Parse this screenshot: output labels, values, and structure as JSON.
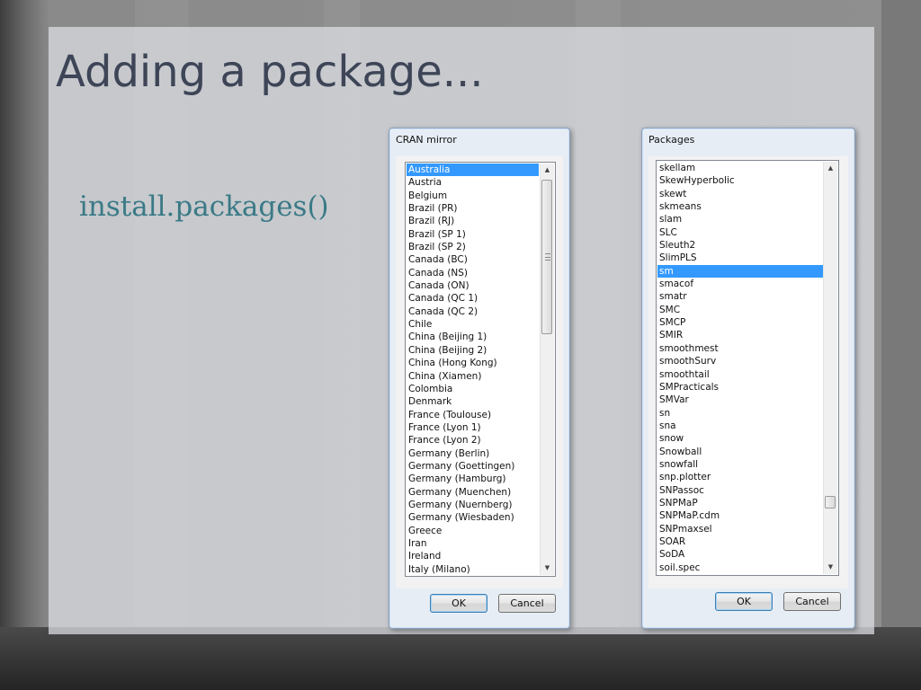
{
  "slide": {
    "title": "Adding a package...",
    "bullet": "install.packages()"
  },
  "cran_dialog": {
    "title": "CRAN mirror",
    "ok_label": "OK",
    "cancel_label": "Cancel",
    "selected_index": 0,
    "items": [
      "Australia",
      "Austria",
      "Belgium",
      "Brazil (PR)",
      "Brazil (RJ)",
      "Brazil (SP 1)",
      "Brazil (SP 2)",
      "Canada (BC)",
      "Canada (NS)",
      "Canada (ON)",
      "Canada (QC 1)",
      "Canada (QC 2)",
      "Chile",
      "China (Beijing 1)",
      "China (Beijing 2)",
      "China (Hong Kong)",
      "China (Xiamen)",
      "Colombia",
      "Denmark",
      "France (Toulouse)",
      "France (Lyon 1)",
      "France (Lyon 2)",
      "Germany (Berlin)",
      "Germany (Goettingen)",
      "Germany (Hamburg)",
      "Germany (Muenchen)",
      "Germany (Nuernberg)",
      "Germany (Wiesbaden)",
      "Greece",
      "Iran",
      "Ireland",
      "Italy (Milano)"
    ]
  },
  "packages_dialog": {
    "title": "Packages",
    "ok_label": "OK",
    "cancel_label": "Cancel",
    "selected_index": 8,
    "items": [
      "skellam",
      "SkewHyperbolic",
      "skewt",
      "skmeans",
      "slam",
      "SLC",
      "Sleuth2",
      "SlimPLS",
      "sm",
      "smacof",
      "smatr",
      "SMC",
      "SMCP",
      "SMIR",
      "smoothmest",
      "smoothSurv",
      "smoothtail",
      "SMPracticals",
      "SMVar",
      "sn",
      "sna",
      "snow",
      "Snowball",
      "snowfall",
      "snp.plotter",
      "SNPassoc",
      "SNPMaP",
      "SNPMaP.cdm",
      "SNPmaxsel",
      "SOAR",
      "SoDA",
      "soil.spec"
    ]
  }
}
